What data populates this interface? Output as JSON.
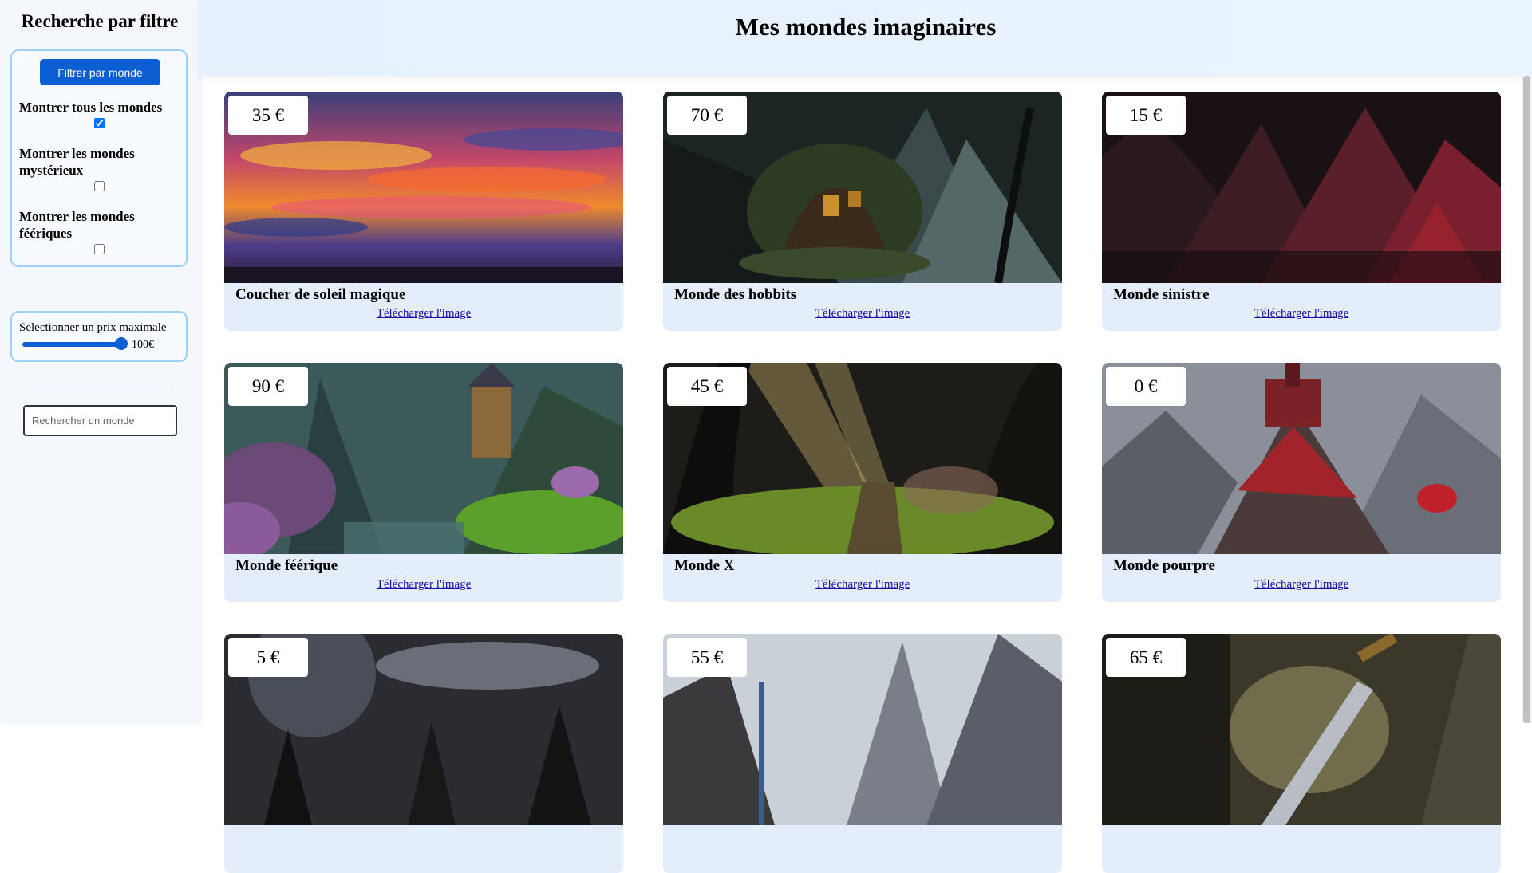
{
  "sidebar": {
    "title": "Recherche par filtre",
    "filter_button": "Filtrer par monde",
    "options": [
      {
        "label": "Montrer tous les mondes",
        "checked": true
      },
      {
        "label": "Montrer les mondes mystérieux",
        "checked": false
      },
      {
        "label": "Montrer les mondes féériques",
        "checked": false
      }
    ],
    "price": {
      "label": "Selectionner un prix maximale",
      "value_text": "100€",
      "value": 100
    },
    "search": {
      "placeholder": "Rechercher un monde"
    }
  },
  "header": {
    "title": "Mes mondes imaginaires"
  },
  "cards": [
    {
      "price": "35 €",
      "title": "Coucher de soleil magique",
      "link": "Télécharger l'image",
      "scene": "sunset"
    },
    {
      "price": "70 €",
      "title": "Monde des hobbits",
      "link": "Télécharger l'image",
      "scene": "hobbit"
    },
    {
      "price": "15 €",
      "title": "Monde sinistre",
      "link": "Télécharger l'image",
      "scene": "sinister"
    },
    {
      "price": "90 €",
      "title": "Monde féérique",
      "link": "Télécharger l'image",
      "scene": "fairy"
    },
    {
      "price": "45 €",
      "title": "Monde X",
      "link": "Télécharger l'image",
      "scene": "forest"
    },
    {
      "price": "0 €",
      "title": "Monde pourpre",
      "link": "Télécharger l'image",
      "scene": "purple"
    },
    {
      "price": "5 €",
      "title": "",
      "link": "",
      "scene": "space"
    },
    {
      "price": "55 €",
      "title": "",
      "link": "",
      "scene": "mountain"
    },
    {
      "price": "65 €",
      "title": "",
      "link": "",
      "scene": "sword"
    }
  ],
  "colors": {
    "accent": "#0c5fd3",
    "card_bg": "#e3eefa",
    "link": "#1a0dab"
  }
}
